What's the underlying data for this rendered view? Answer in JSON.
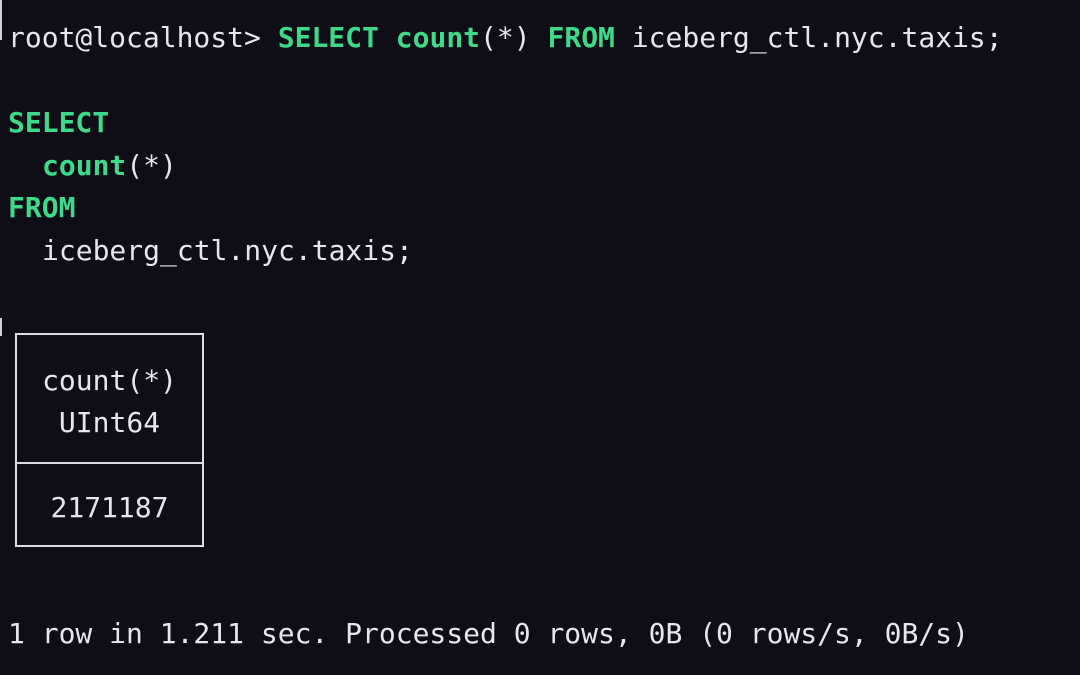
{
  "prompt": {
    "user_host": "root@localhost>",
    "command_parts": [
      {
        "text": "SELECT",
        "keyword": true
      },
      {
        "text": "count",
        "keyword": true
      },
      {
        "text": "(*)",
        "keyword": false
      },
      {
        "text": "FROM",
        "keyword": true
      },
      {
        "text": "iceberg_ctl.nyc.taxis;",
        "keyword": false
      }
    ]
  },
  "formatted_query": {
    "select_kw": "SELECT",
    "count_kw": "count",
    "count_args": "(*)",
    "from_kw": "FROM",
    "table": "iceberg_ctl.nyc.taxis;"
  },
  "result": {
    "column_name": "count(*)",
    "column_type": "UInt64",
    "rows": [
      "2171187"
    ]
  },
  "status": "1 row in 1.211 sec. Processed 0 rows, 0B (0 rows/s, 0B/s)",
  "colors": {
    "background": "#0f0e17",
    "keyword": "#3fd98a",
    "text": "#e7e6ee",
    "border": "#dcdce4"
  }
}
